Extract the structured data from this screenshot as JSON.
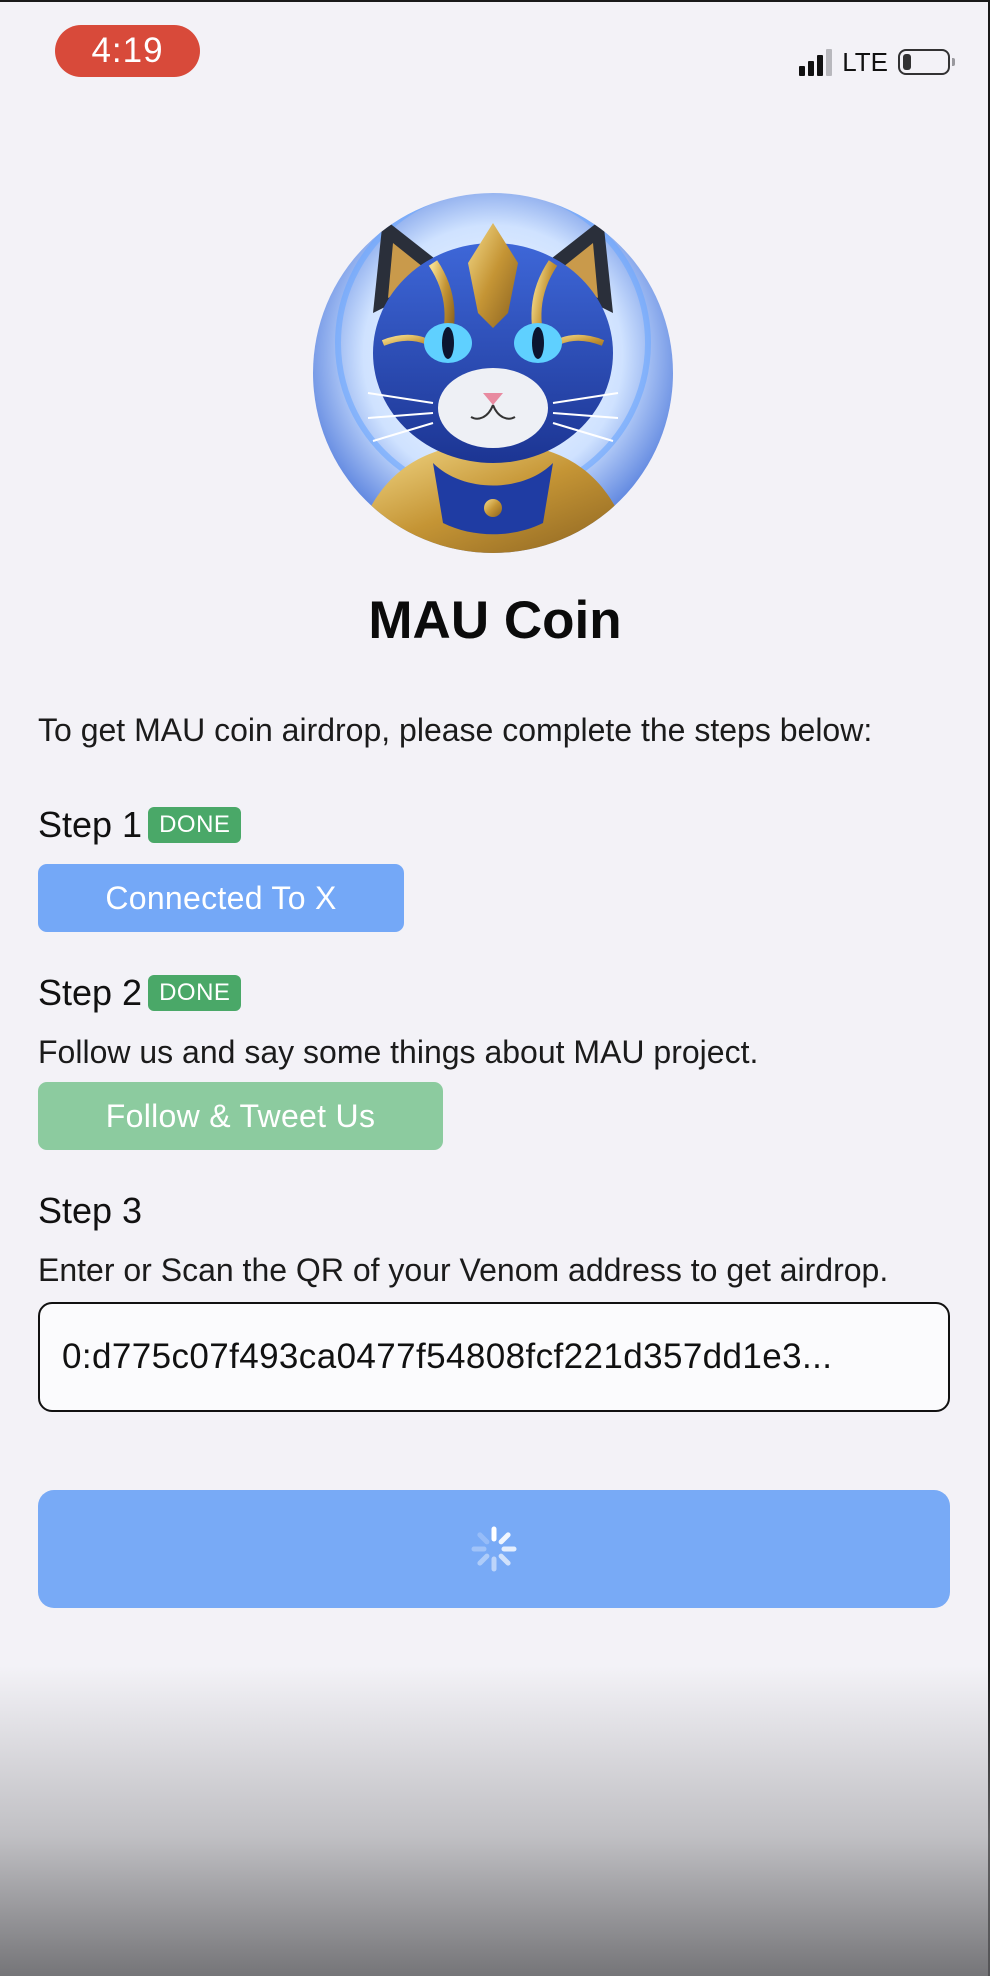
{
  "status_bar": {
    "time": "4:19",
    "network": "LTE",
    "battery_level": 0.2
  },
  "header": {
    "avatar_icon": "cat-mascot-icon",
    "title": "MAU Coin"
  },
  "intro": "To get MAU coin airdrop, please complete the steps below:",
  "steps": [
    {
      "label": "Step 1",
      "badge": "DONE",
      "button_label": "Connected To X",
      "button_color": "#74a8f7"
    },
    {
      "label": "Step 2",
      "badge": "DONE",
      "description": "Follow us and say some things about MAU project.",
      "button_label": "Follow & Tweet Us",
      "button_color": "#8ccb9f"
    },
    {
      "label": "Step 3",
      "description": "Enter or Scan the QR of your Venom address to get airdrop.",
      "address_value": "0:d775c07f493ca0477f54808fcf221d357dd1e3..."
    }
  ],
  "submit": {
    "state": "loading",
    "icon": "spinner-icon",
    "color": "#78aaf6"
  },
  "colors": {
    "background": "#f3f2f7",
    "done_badge": "#4aa868",
    "time_pill": "#d84a3a"
  }
}
